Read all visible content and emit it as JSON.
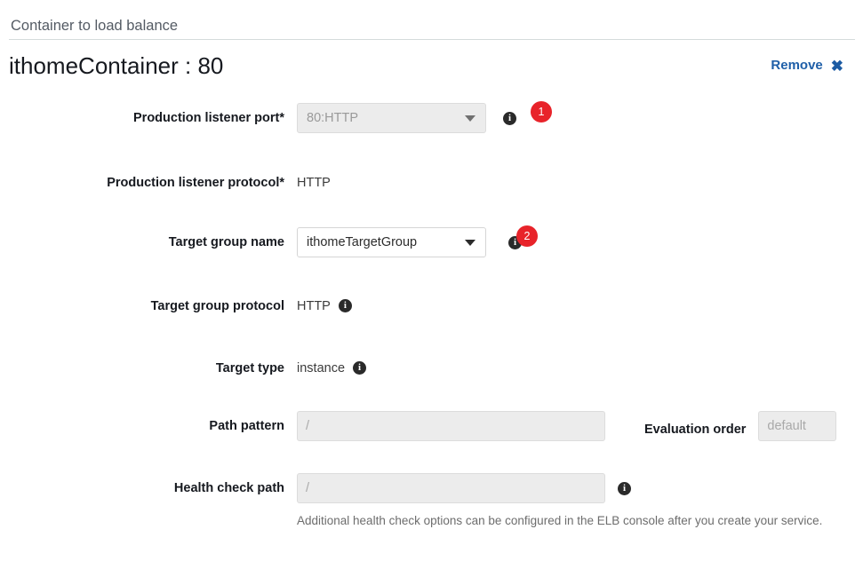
{
  "section": {
    "header_title": "Container to load balance",
    "container_title": "ithomeContainer : 80",
    "remove_label": "Remove",
    "remove_icon_glyph": "✖"
  },
  "colors": {
    "badge_red": "#e8232a",
    "link_blue": "#1f5fa8",
    "label_dark": "#16191f",
    "header_gray": "#545b64",
    "disabled_bg": "#ececec"
  },
  "fields": {
    "production_listener_port": {
      "label": "Production listener port*",
      "value": "80:HTTP",
      "info_glyph": "i",
      "badge": "1"
    },
    "production_listener_protocol": {
      "label": "Production listener protocol*",
      "value": "HTTP"
    },
    "target_group_name": {
      "label": "Target group name",
      "value": "ithomeTargetGroup",
      "info_glyph": "i",
      "badge": "2"
    },
    "target_group_protocol": {
      "label": "Target group protocol",
      "value": "HTTP",
      "info_glyph": "i"
    },
    "target_type": {
      "label": "Target type",
      "value": "instance",
      "info_glyph": "i"
    },
    "path_pattern": {
      "label": "Path pattern",
      "value": "",
      "placeholder": "/"
    },
    "evaluation_order": {
      "label": "Evaluation order",
      "value": "",
      "placeholder": "default"
    },
    "health_check_path": {
      "label": "Health check path",
      "value": "",
      "placeholder": "/",
      "info_glyph": "i"
    }
  },
  "hint": {
    "text": "Additional health check options can be configured in the ELB console after you create your service."
  }
}
